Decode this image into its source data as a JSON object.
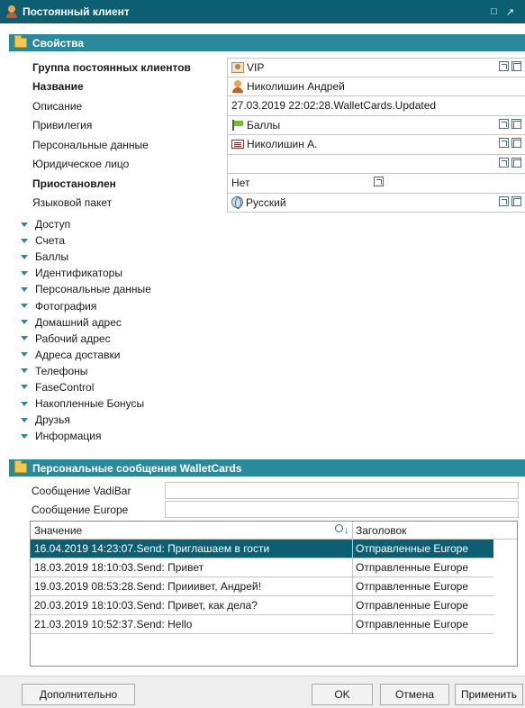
{
  "window": {
    "title": "Постоянный клиент"
  },
  "properties_section": {
    "title": "Свойства"
  },
  "properties": [
    {
      "label": "Группа постоянных клиентов",
      "bold": true,
      "value": "VIP",
      "icon": "vip-icon"
    },
    {
      "label": "Название",
      "bold": true,
      "value": "Николишин Андрей",
      "icon": "person-icon"
    },
    {
      "label": "Описание",
      "bold": false,
      "value": "27.03.2019 22:02:28.WalletCards.Updated",
      "icon": ""
    },
    {
      "label": "Привилегия",
      "bold": false,
      "value": "Баллы",
      "icon": "flag-icon"
    },
    {
      "label": "Персональные данные",
      "bold": false,
      "value": "Николишин А.",
      "icon": "card-icon"
    },
    {
      "label": "Юридическое лицо",
      "bold": false,
      "value": "",
      "icon": ""
    },
    {
      "label": "Приостановлен",
      "bold": true,
      "value": "Нет",
      "icon": ""
    },
    {
      "label": "Языковой пакет",
      "bold": false,
      "value": "Русский",
      "icon": "globe-icon"
    }
  ],
  "groups": [
    "Доступ",
    "Счета",
    "Баллы",
    "Идентификаторы",
    "Персональные данные",
    "Фотография",
    "Домашний адрес",
    "Рабочий адрес",
    "Адреса доставки",
    "Телефоны",
    "FaseControl",
    "Накопленные Бонусы",
    "Друзья",
    "Информация"
  ],
  "messages_section": {
    "title": "Персональные сообщения WalletCards",
    "field1_label": "Сообщение VadiBar",
    "field1_value": "",
    "field2_label": "Сообщение Europe",
    "field2_value": ""
  },
  "table": {
    "col1": "Значение",
    "col2": "Заголовок",
    "rows": [
      {
        "value": "16.04.2019 14:23:07.Send: Приглашаем в гости",
        "title": "Отправленные Europe",
        "selected": true
      },
      {
        "value": "18.03.2019 18:10:03.Send: Привет",
        "title": "Отправленные Europe",
        "selected": false
      },
      {
        "value": "19.03.2019 08:53:28.Send: Прииивет, Андрей!",
        "title": "Отправленные Europe",
        "selected": false
      },
      {
        "value": "20.03.2019 18:10:03.Send: Привет, как дела?",
        "title": "Отправленные Europe",
        "selected": false
      },
      {
        "value": "21.03.2019 10:52:37.Send: Hello",
        "title": "Отправленные Europe",
        "selected": false
      }
    ]
  },
  "buttons": {
    "more": "Дополнительно",
    "ok": "OK",
    "cancel": "Отмена",
    "apply": "Применить"
  },
  "colors": {
    "accent": "#0b5f70",
    "section": "#2a8a9d"
  }
}
